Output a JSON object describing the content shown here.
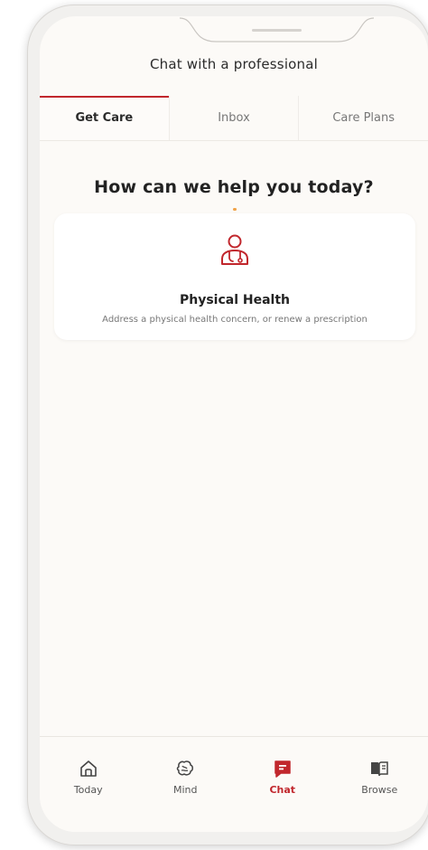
{
  "header": {
    "title": "Chat with a professional"
  },
  "tabs": [
    {
      "label": "Get Care"
    },
    {
      "label": "Inbox"
    },
    {
      "label": "Care Plans"
    }
  ],
  "main": {
    "question": "How can we help you today?",
    "card": {
      "icon": "doctor-icon",
      "title": "Physical Health",
      "description": "Address a physical health concern, or renew a prescription"
    }
  },
  "bottom_nav": [
    {
      "label": "Today",
      "icon": "home-icon"
    },
    {
      "label": "Mind",
      "icon": "brain-icon"
    },
    {
      "label": "Chat",
      "icon": "chat-icon"
    },
    {
      "label": "Browse",
      "icon": "book-icon"
    }
  ],
  "colors": {
    "accent": "#c1272d",
    "background": "#fcfaf7"
  }
}
